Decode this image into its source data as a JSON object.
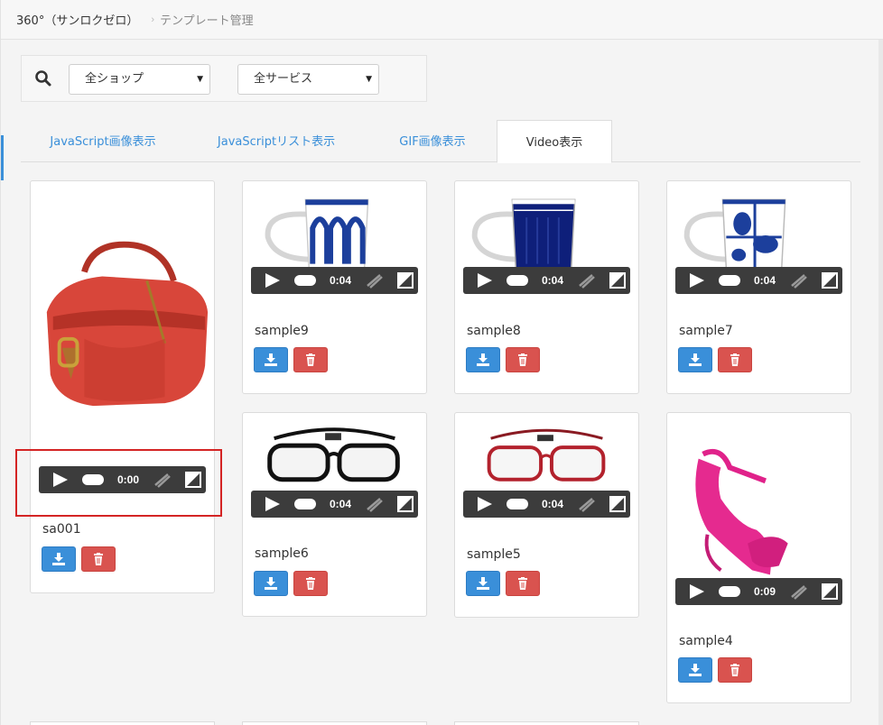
{
  "breadcrumb": {
    "home": "360°（サンロクゼロ）",
    "separator": "›",
    "current": "テンプレート管理"
  },
  "filters": {
    "search_icon": "search-icon",
    "shop_select": "全ショップ",
    "service_select": "全サービス"
  },
  "tabs": [
    {
      "label": "JavaScript画像表示",
      "active": false
    },
    {
      "label": "JavaScriptリスト表示",
      "active": false
    },
    {
      "label": "GIF画像表示",
      "active": false
    },
    {
      "label": "Video表示",
      "active": true
    }
  ],
  "cards": [
    {
      "name": "sa001",
      "time": "0:00",
      "image": "red-handbag",
      "highlighted": true
    },
    {
      "name": "sample9",
      "time": "0:04",
      "image": "mug-blue-arches"
    },
    {
      "name": "sample8",
      "time": "0:04",
      "image": "mug-navy"
    },
    {
      "name": "sample7",
      "time": "0:04",
      "image": "mug-blue-ovals"
    },
    {
      "name": "sample6",
      "time": "0:04",
      "image": "glasses-black"
    },
    {
      "name": "sample5",
      "time": "0:04",
      "image": "glasses-red"
    },
    {
      "name": "sample4",
      "time": "0:09",
      "image": "pink-heel-shoe"
    }
  ],
  "colors": {
    "primary": "#3a8fd9",
    "danger": "#d9534f",
    "highlight": "#d42424",
    "player": "#3c3c3c"
  }
}
